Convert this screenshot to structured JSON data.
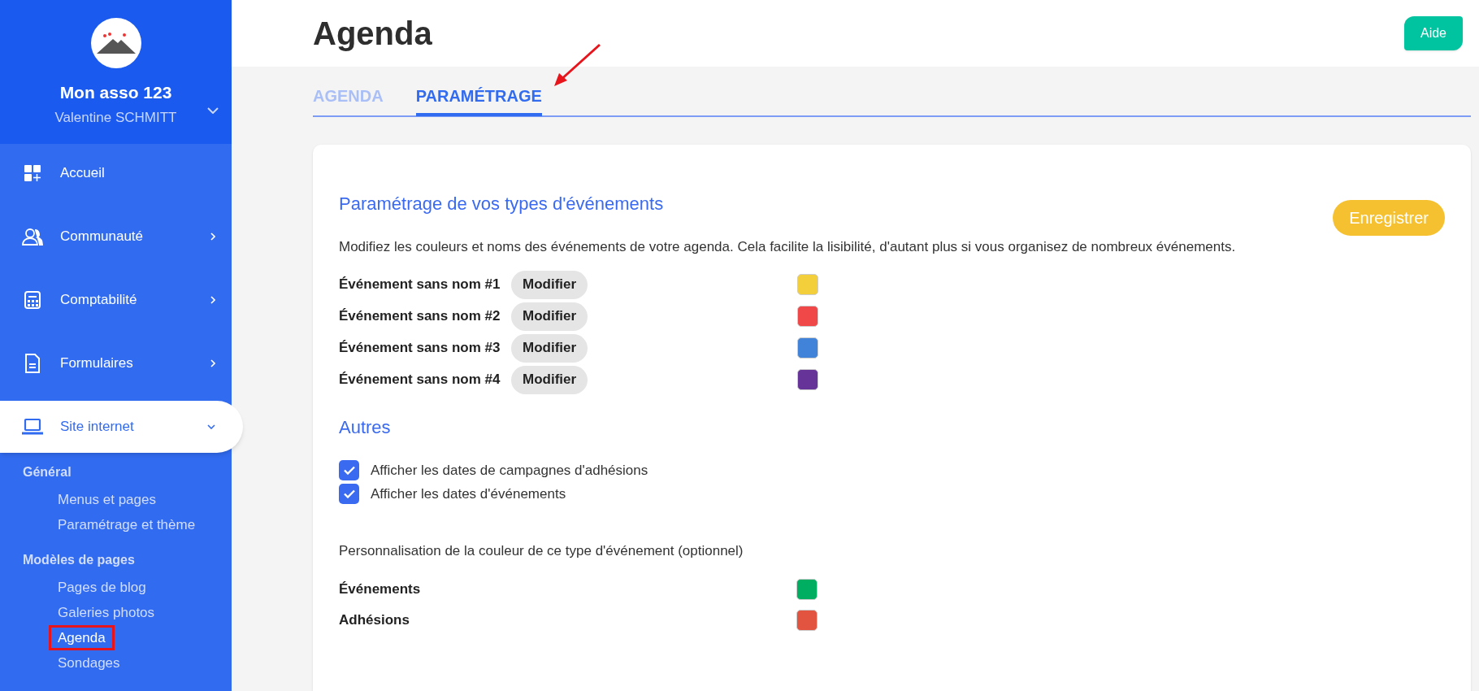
{
  "sidebar": {
    "org_name": "Mon asso 123",
    "user_name": "Valentine SCHMITT",
    "items": [
      {
        "label": "Accueil",
        "has_submenu": false,
        "selected": false
      },
      {
        "label": "Communauté",
        "has_submenu": true,
        "selected": false
      },
      {
        "label": "Comptabilité",
        "has_submenu": true,
        "selected": false
      },
      {
        "label": "Formulaires",
        "has_submenu": true,
        "selected": false
      },
      {
        "label": "Site internet",
        "has_submenu": true,
        "selected": true
      }
    ],
    "groups": [
      {
        "title": "Général",
        "items": [
          {
            "label": "Menus et pages",
            "selected": false
          },
          {
            "label": "Paramétrage et thème",
            "selected": false
          }
        ]
      },
      {
        "title": "Modèles de pages",
        "items": [
          {
            "label": "Pages de blog",
            "selected": false
          },
          {
            "label": "Galeries photos",
            "selected": false
          },
          {
            "label": "Agenda",
            "selected": true
          },
          {
            "label": "Sondages",
            "selected": false
          }
        ]
      }
    ]
  },
  "header": {
    "title": "Agenda",
    "help_button": "Aide"
  },
  "tabs": [
    {
      "label": "AGENDA",
      "selected": false
    },
    {
      "label": "PARAMÉTRAGE",
      "selected": true
    }
  ],
  "event_types": {
    "title": "Paramétrage de vos types d'événements",
    "save_button": "Enregistrer",
    "description": "Modifiez les couleurs et noms des événements de votre agenda. Cela facilite la lisibilité, d'autant plus si vous organisez de nombreux événements.",
    "rows": [
      {
        "name": "Événement sans nom #1",
        "button": "Modifier",
        "color": "#f4cf3c"
      },
      {
        "name": "Événement sans nom #2",
        "button": "Modifier",
        "color": "#f04848"
      },
      {
        "name": "Événement sans nom #3",
        "button": "Modifier",
        "color": "#4083d8"
      },
      {
        "name": "Événement sans nom #4",
        "button": "Modifier",
        "color": "#663399"
      }
    ]
  },
  "others": {
    "title": "Autres",
    "options": [
      {
        "label": "Afficher les dates de campagnes d'adhésions",
        "checked": true
      },
      {
        "label": "Afficher les dates d'événements",
        "checked": true
      }
    ],
    "color_note": "Personnalisation de la couleur de ce type d'événement (optionnel)",
    "colors": [
      {
        "name": "Événements",
        "color": "#00ae62"
      },
      {
        "name": "Adhésions",
        "color": "#e25440"
      }
    ]
  }
}
